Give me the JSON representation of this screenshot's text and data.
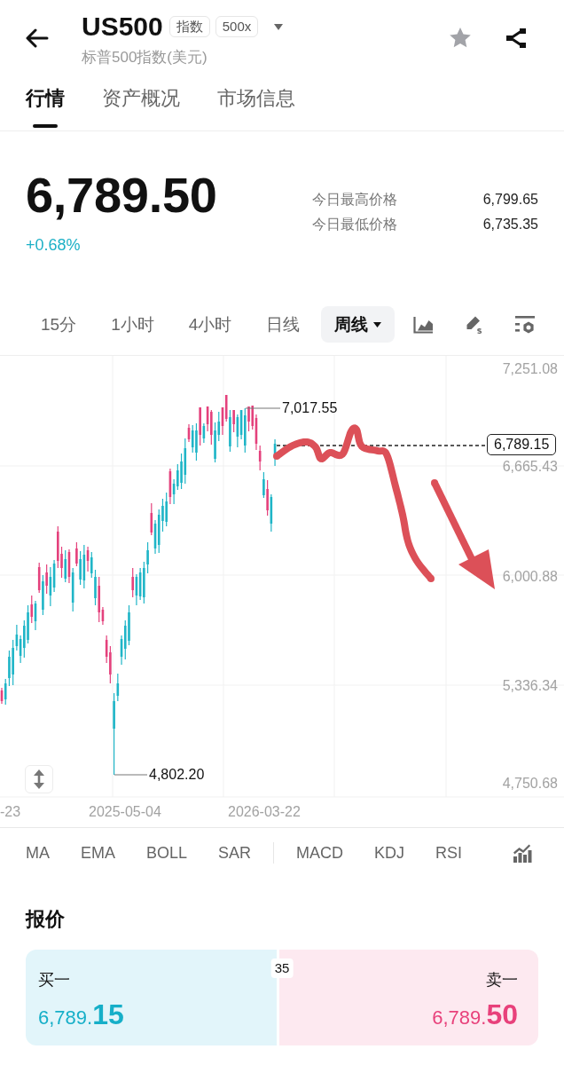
{
  "header": {
    "title": "US500",
    "badges": [
      "指数",
      "500x"
    ],
    "subtitle": "标普500指数(美元)",
    "starred": false
  },
  "tabs": [
    {
      "label": "行情",
      "selected": true
    },
    {
      "label": "资产概况",
      "selected": false
    },
    {
      "label": "市场信息",
      "selected": false
    }
  ],
  "price": {
    "last": "6,789.50",
    "change": "+0.68%",
    "stats": [
      {
        "label": "今日最高价格",
        "value": "6,799.65"
      },
      {
        "label": "今日最低价格",
        "value": "6,735.35"
      }
    ]
  },
  "timeframes": [
    {
      "label": "15分",
      "selected": false,
      "has_menu": false
    },
    {
      "label": "1小时",
      "selected": false,
      "has_menu": false
    },
    {
      "label": "4小时",
      "selected": false,
      "has_menu": false
    },
    {
      "label": "日线",
      "selected": false,
      "has_menu": false
    },
    {
      "label": "周线",
      "selected": true,
      "has_menu": true
    }
  ],
  "chart": {
    "y_labels": [
      "7,251.08",
      "6,665.43",
      "6,000.88",
      "5,336.34",
      "4,750.68"
    ],
    "x_labels": [
      "-23",
      "2025-05-04",
      "2026-03-22"
    ],
    "high_label": "7,017.55",
    "low_label": "4,802.20",
    "last_price": "6,789.15"
  },
  "indicators": {
    "main": [
      "MA",
      "EMA",
      "BOLL",
      "SAR"
    ],
    "sub": [
      "MACD",
      "KDJ",
      "RSI"
    ]
  },
  "quote": {
    "title": "报价",
    "spread": "35",
    "bid": {
      "label": "买一",
      "price_main": "6,789.",
      "price_fraction": "15"
    },
    "ask": {
      "label": "卖一",
      "price_main": "6,789.",
      "price_fraction": "50"
    }
  }
}
